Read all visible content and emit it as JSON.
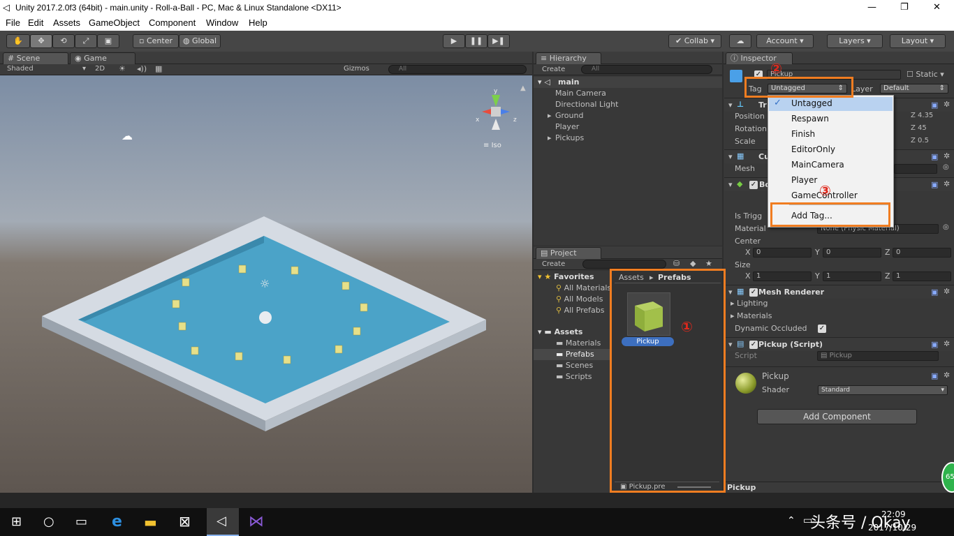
{
  "window": {
    "title": "Unity 2017.2.0f3 (64bit) - main.unity - Roll-a-Ball - PC, Mac & Linux Standalone <DX11>"
  },
  "menu": [
    "File",
    "Edit",
    "Assets",
    "GameObject",
    "Component",
    "Window",
    "Help"
  ],
  "toolbar": {
    "center": "Center",
    "global": "Global",
    "collab": "Collab",
    "account": "Account",
    "layers": "Layers",
    "layout": "Layout"
  },
  "scene": {
    "tab": "Scene",
    "game_tab": "Game",
    "shaded": "Shaded",
    "mode2d": "2D",
    "gizmos": "Gizmos",
    "search": "All",
    "iso": "Iso"
  },
  "hierarchy": {
    "tab": "Hierarchy",
    "create": "Create",
    "search": "All",
    "root": "main",
    "items": [
      "Main Camera",
      "Directional Light",
      "Ground",
      "Player",
      "Pickups"
    ]
  },
  "project": {
    "tab": "Project",
    "create": "Create",
    "favorites": "Favorites",
    "fav_items": [
      "All Materials",
      "All Models",
      "All Prefabs"
    ],
    "assets": "Assets",
    "asset_folders": [
      "Materials",
      "Prefabs",
      "Scenes",
      "Scripts"
    ],
    "breadcrumb_root": "Assets",
    "breadcrumb_leaf": "Prefabs",
    "prefab_name": "Pickup",
    "footer": "Pickup.pre"
  },
  "inspector": {
    "tab": "Inspector",
    "object_name": "Pickup",
    "static": "Static",
    "tag_label": "Tag",
    "tag_value": "Untagged",
    "layer_label": "Layer",
    "layer_value": "Default",
    "transform": {
      "title": "Tr",
      "pos_label": "Position",
      "rot_label": "Rotation",
      "scale_label": "Scale",
      "pos_z": "Z 4.35",
      "rot_z": "Z 45",
      "scale_z": "Z 0.5"
    },
    "mesh_filter": {
      "title": "Cu",
      "mesh_label": "Mesh"
    },
    "box_collider": {
      "title": "Bo",
      "trigger": "Is Trigg",
      "material_label": "Material",
      "material_value": "None (Physic Material)",
      "center": "Center",
      "size": "Size",
      "cx": "0",
      "cy": "0",
      "cz": "0",
      "sx": "1",
      "sy": "1",
      "sz": "1"
    },
    "mesh_renderer": {
      "title": "Mesh Renderer",
      "lighting": "Lighting",
      "materials": "Materials",
      "dynamic": "Dynamic Occluded"
    },
    "script": {
      "title": "Pickup (Script)",
      "label": "Script",
      "value": "Pickup"
    },
    "material": {
      "name": "Pickup",
      "shader_label": "Shader",
      "shader": "Standard"
    },
    "add_component": "Add Component",
    "footer": "Pickup"
  },
  "tag_dropdown": [
    "Untagged",
    "Respawn",
    "Finish",
    "EditorOnly",
    "MainCamera",
    "Player",
    "GameController",
    "Add Tag..."
  ],
  "annotations": [
    "①",
    "②",
    "③"
  ],
  "taskbar": {
    "time": "22:09",
    "date": "2017/10/29",
    "watermark": "头条号 / Okay",
    "badge": "65"
  },
  "colors": {
    "accent": "#f07d21",
    "marker": "#e0281c",
    "selection": "#3d6fbf"
  }
}
